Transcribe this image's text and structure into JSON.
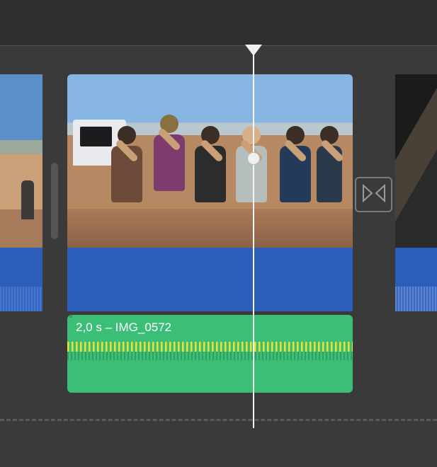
{
  "timeline": {
    "clip_prev": {
      "name": "previous-clip"
    },
    "clip_main": {
      "name": "main-video-clip"
    },
    "clip_next": {
      "name": "next-clip"
    },
    "detached_audio": {
      "label": "2,0 s – IMG_0572"
    },
    "transition": {
      "icon_name": "cross-dissolve-icon"
    },
    "playhead": {
      "position_label": "playhead"
    },
    "colors": {
      "video_band": "#2d5dbb",
      "audio_clip": "#3bbf77",
      "background": "#3a3a3a"
    }
  }
}
